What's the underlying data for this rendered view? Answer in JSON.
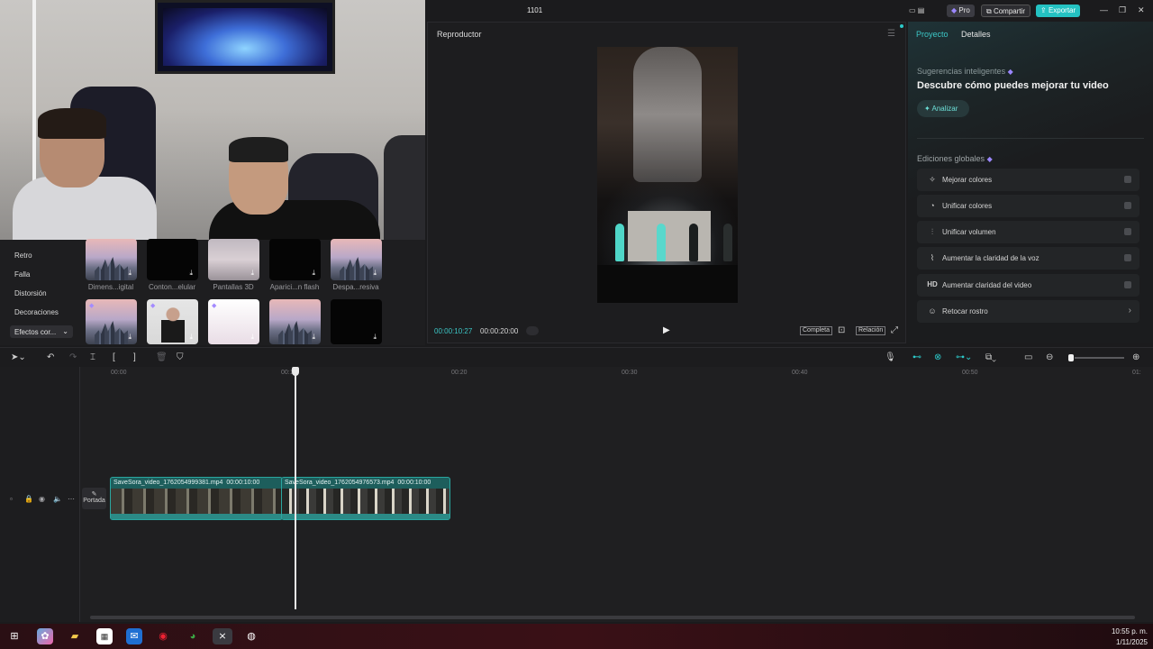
{
  "app": {
    "project_name": "1101",
    "pro_label": "Pro",
    "share_label": "Compartir",
    "export_label": "Exportar"
  },
  "effects": {
    "categories": [
      "Retro",
      "Falla",
      "Distorsión",
      "Decoraciones"
    ],
    "dropdown": "Efectos cor...",
    "thumbs": [
      "Dimens...igital",
      "Conton...elular",
      "Pantallas 3D",
      "Aparici...n flash",
      "Despa...resiva"
    ]
  },
  "player": {
    "title": "Reproductor",
    "current_time": "00:00:10:27",
    "duration": "00:00:20:00",
    "btn_full": "Completa",
    "btn_ratio": "Relación"
  },
  "right_panel": {
    "tabs": [
      "Proyecto",
      "Detalles"
    ],
    "suggestions_label": "Sugerencias inteligentes",
    "suggestions_title": "Descubre cómo puedes mejorar tu video",
    "analyze_label": "Analizar",
    "global_label": "Ediciones globales",
    "items": [
      {
        "label": "Mejorar colores",
        "icon": "wand-icon"
      },
      {
        "label": "Unificar colores",
        "icon": "palette-icon"
      },
      {
        "label": "Unificar volumen",
        "icon": "sliders-icon"
      },
      {
        "label": "Aumentar la claridad de la voz",
        "icon": "waveform-icon"
      },
      {
        "label": "Aumentar claridad del video",
        "icon": "hd-icon",
        "glyph": "HD"
      },
      {
        "label": "Retocar rostro",
        "icon": "face-icon"
      }
    ]
  },
  "timeline": {
    "ticks": [
      "00:00",
      "00:10",
      "00:20",
      "00:30",
      "00:40",
      "00:50",
      "01:"
    ],
    "cover_label": "Portada",
    "clips": [
      {
        "name": "SaveSora_video_1762054999381.mp4",
        "duration": "00:00:10:00"
      },
      {
        "name": "SaveSora_video_1762054976573.mp4",
        "duration": "00:00:10:00"
      }
    ]
  },
  "taskbar": {
    "time": "10:55 p. m.",
    "date": "1/11/2025"
  },
  "colors": {
    "accent": "#2cc9c9",
    "background": "#1b1b1d"
  }
}
